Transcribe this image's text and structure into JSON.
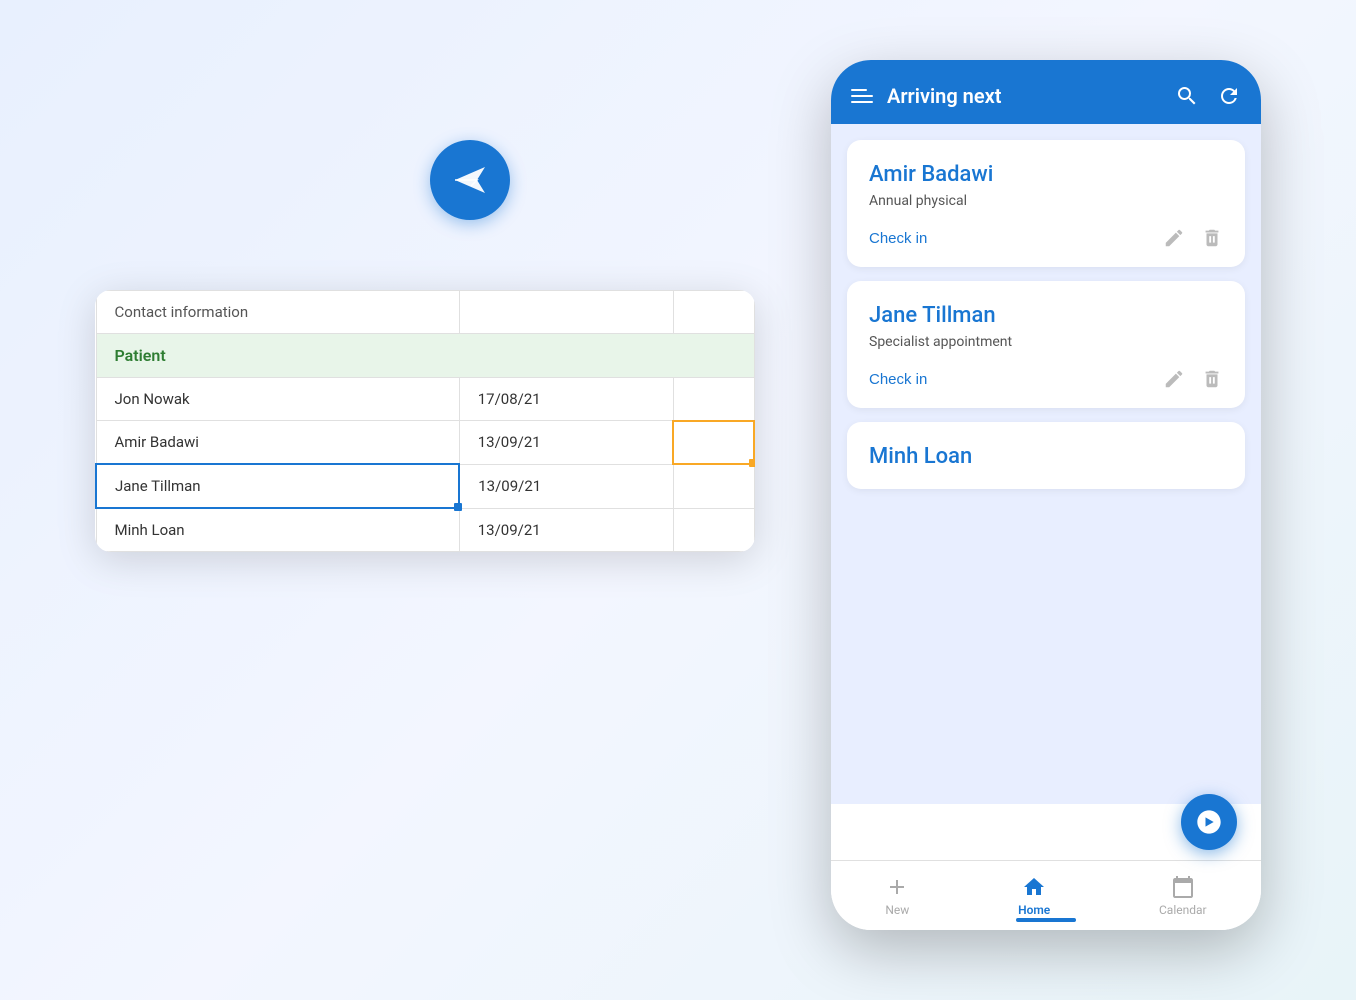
{
  "app": {
    "bg_color": "#e8edf5"
  },
  "paper_plane": {
    "alt": "Paper plane logo"
  },
  "spreadsheet": {
    "header_row": {
      "col1": "Contact information",
      "col2": "",
      "col3": ""
    },
    "section_row": {
      "label": "Patient"
    },
    "rows": [
      {
        "name": "Jon Nowak",
        "date": "17/08/21",
        "col3": ""
      },
      {
        "name": "Amir Badawi",
        "date": "13/09/21",
        "col3": ""
      },
      {
        "name": "Jane Tillman",
        "date": "13/09/21",
        "col3": ""
      },
      {
        "name": "Minh Loan",
        "date": "13/09/21",
        "col3": ""
      }
    ]
  },
  "phone": {
    "header": {
      "title": "Arriving next",
      "search_icon": "search",
      "refresh_icon": "refresh",
      "menu_icon": "menu"
    },
    "patients": [
      {
        "name": "Amir Badawi",
        "appointment": "Annual physical",
        "check_in_label": "Check in"
      },
      {
        "name": "Jane Tillman",
        "appointment": "Specialist appointment",
        "check_in_label": "Check in"
      },
      {
        "name": "Minh Loan",
        "appointment": "",
        "check_in_label": ""
      }
    ],
    "bottom_nav": [
      {
        "label": "New",
        "icon": "plus",
        "active": false
      },
      {
        "label": "Home",
        "icon": "home",
        "active": true
      },
      {
        "label": "Calendar",
        "icon": "calendar",
        "active": false
      }
    ],
    "fab_icon": "arrow-right-circle"
  }
}
